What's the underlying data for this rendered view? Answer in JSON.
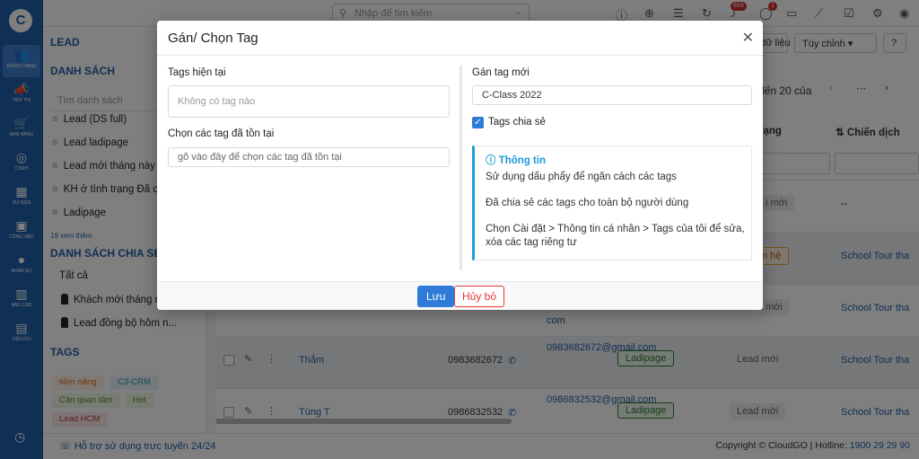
{
  "topbar": {
    "search_placeholder": "Nhập để tìm kiếm",
    "notif_count": "693",
    "chat_count": "1"
  },
  "rail": {
    "items": [
      {
        "label": "Khách hàng",
        "icon": "users-icon",
        "glyph": "👥"
      },
      {
        "label": "Tiếp thị",
        "icon": "megaphone-icon",
        "glyph": "📣"
      },
      {
        "label": "Bán hàng",
        "icon": "cart-icon",
        "glyph": "🛒"
      },
      {
        "label": "CSKH",
        "icon": "support-icon",
        "glyph": "◎"
      },
      {
        "label": "Sự kiện",
        "icon": "calendar-icon",
        "glyph": "▦"
      },
      {
        "label": "Công việc",
        "icon": "briefcase-icon",
        "glyph": "▣"
      },
      {
        "label": "Nhân sự",
        "icon": "person-icon",
        "glyph": "●"
      },
      {
        "label": "Báo cáo",
        "icon": "chart-icon",
        "glyph": "▥"
      },
      {
        "label": "Tiện ích",
        "icon": "tools-icon",
        "glyph": "▤"
      }
    ]
  },
  "sidebar": {
    "lead_title": "LEAD",
    "list_title": "DANH SÁCH",
    "search_placeholder": "Tìm danh sách",
    "lists": [
      "Lead (DS full)",
      "Lead ladipage",
      "Lead mới tháng này",
      "KH ở tình trạng Đã c",
      "Ladipage"
    ],
    "more_link": "19 xem thêm",
    "shared_title": "DANH SÁCH CHIA SẺ",
    "shared_all": "Tất cả",
    "shared_items": [
      "Khách mới tháng n",
      "Lead đồng bộ hôm n..."
    ],
    "tags_title": "TAGS",
    "tags": [
      "tiềm năng",
      "C3-CRM",
      "Cần quan tâm",
      "Hot",
      "Lead HCM"
    ]
  },
  "toolbar": {
    "data_label": "dữ liệu",
    "custom_label": "Tùy chỉnh",
    "pagination_label": "đến 20 của",
    "col_status": "rạng",
    "col_campaign": "Chiến dịch"
  },
  "rows": [
    {
      "status": "i mới",
      "campaign": "--"
    },
    {
      "status": "n hệ",
      "campaign": "School Tour tha"
    },
    {
      "email": "com",
      "status": "mới",
      "campaign": "School Tour tha"
    },
    {
      "name": "Thắm",
      "phone": "0983682672",
      "email": "0983682672@gmail.com",
      "source": "Ladipage",
      "status": "Lead mới",
      "campaign": "School Tour tha"
    },
    {
      "name": "Tùng T",
      "phone": "0986832532",
      "email": "0986832532@gmail.com",
      "source": "Ladipage",
      "status": "Lead mới",
      "campaign": "School Tour tha"
    }
  ],
  "footer": {
    "support": "Hỗ trợ sử dụng trực tuyến 24/24",
    "copyright": "Copyright © CloudGO | Hotline:",
    "hotline": "1900 29 29 90"
  },
  "modal": {
    "title": "Gán/ Chọn Tag",
    "current_tags_label": "Tags hiện tại",
    "current_tags_empty": "Không có tag nào",
    "choose_existing_label": "Chọn các tag đã tồn tại",
    "choose_existing_placeholder": "gõ vào đây để chọn các tag đã tồn tại",
    "new_tag_label": "Gán tag mới",
    "new_tag_value": "C-Class 2022",
    "share_label": "Tags chia sẻ",
    "share_checked": true,
    "info": {
      "title": "Thông tin",
      "lines": [
        "Sử dụng dấu phẩy để ngăn cách các tags",
        "Đã chia sẻ các tags cho toàn bộ người dùng",
        "Chọn Cài đặt > Thông tin cá nhân > Tags của tôi để sửa, xóa các tag riêng tư"
      ]
    },
    "save_label": "Lưu",
    "cancel_label": "Hủy bỏ"
  }
}
